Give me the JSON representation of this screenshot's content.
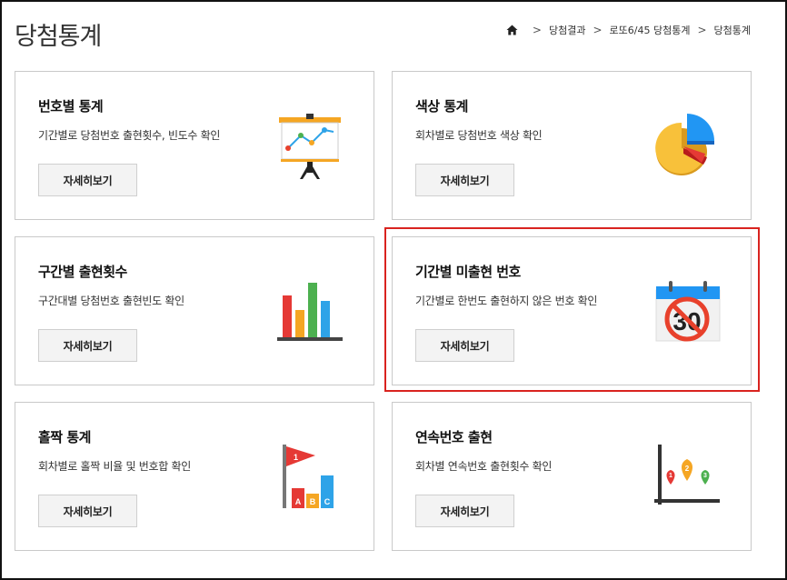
{
  "header": {
    "title": "당첨통계",
    "breadcrumb": [
      "당첨결과",
      "로또6/45 당첨통계",
      "당첨통계"
    ]
  },
  "cards": [
    {
      "title": "번호별 통계",
      "desc": "기간별로 당첨번호 출현횟수, 빈도수 확인",
      "button": "자세히보기",
      "icon": "line-chart-easel-icon"
    },
    {
      "title": "색상 통계",
      "desc": "회차별로 당첨번호 색상 확인",
      "button": "자세히보기",
      "icon": "pie-chart-icon"
    },
    {
      "title": "구간별 출현횟수",
      "desc": "구간대별 당첨번호 출현빈도 확인",
      "button": "자세히보기",
      "icon": "bar-chart-icon"
    },
    {
      "title": "기간별 미출현 번호",
      "desc": "기간별로 한번도 출현하지 않은 번호 확인",
      "button": "자세히보기",
      "icon": "no-calendar-icon"
    },
    {
      "title": "홀짝 통계",
      "desc": "회차별로 홀짝 비율 및 번호합 확인",
      "button": "자세히보기",
      "icon": "flag-bars-icon"
    },
    {
      "title": "연속번호 출현",
      "desc": "회차별 연속번호 출현횟수 확인",
      "button": "자세히보기",
      "icon": "map-pins-chart-icon"
    }
  ],
  "icon_text": {
    "calendar_number": "30",
    "flag_number": "1",
    "bar_letters": [
      "A",
      "B",
      "C"
    ],
    "pin_numbers": [
      "1",
      "2",
      "3"
    ]
  },
  "colors": {
    "highlight": "#d9231f",
    "red": "#e8412c",
    "orange": "#f5a623",
    "green": "#4cb04f",
    "blue": "#2ea3e8",
    "yellow": "#f8c13a"
  }
}
